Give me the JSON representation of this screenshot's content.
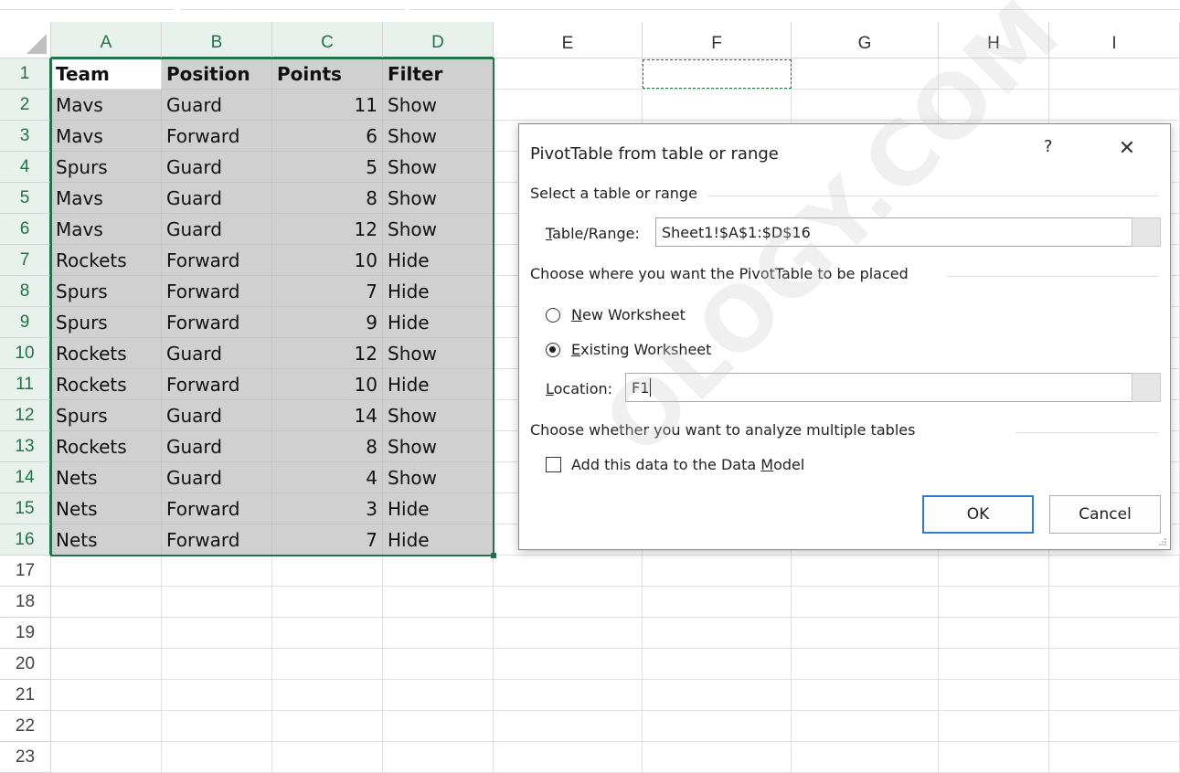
{
  "columns": [
    "A",
    "B",
    "C",
    "D",
    "E",
    "F",
    "G",
    "H",
    "I"
  ],
  "rows": [
    "1",
    "2",
    "3",
    "4",
    "5",
    "6",
    "7",
    "8",
    "9",
    "10",
    "11",
    "12",
    "13",
    "14",
    "15",
    "16",
    "17",
    "18",
    "19",
    "20",
    "21",
    "22",
    "23"
  ],
  "table": {
    "headers": [
      "Team",
      "Position",
      "Points",
      "Filter"
    ],
    "data": [
      [
        "Mavs",
        "Guard",
        "11",
        "Show"
      ],
      [
        "Mavs",
        "Forward",
        "6",
        "Show"
      ],
      [
        "Spurs",
        "Guard",
        "5",
        "Show"
      ],
      [
        "Mavs",
        "Guard",
        "8",
        "Show"
      ],
      [
        "Mavs",
        "Guard",
        "12",
        "Show"
      ],
      [
        "Rockets",
        "Forward",
        "10",
        "Hide"
      ],
      [
        "Spurs",
        "Forward",
        "7",
        "Hide"
      ],
      [
        "Spurs",
        "Forward",
        "9",
        "Hide"
      ],
      [
        "Rockets",
        "Guard",
        "12",
        "Show"
      ],
      [
        "Rockets",
        "Forward",
        "10",
        "Hide"
      ],
      [
        "Spurs",
        "Guard",
        "14",
        "Show"
      ],
      [
        "Rockets",
        "Guard",
        "8",
        "Show"
      ],
      [
        "Nets",
        "Guard",
        "4",
        "Show"
      ],
      [
        "Nets",
        "Forward",
        "3",
        "Hide"
      ],
      [
        "Nets",
        "Forward",
        "7",
        "Hide"
      ]
    ]
  },
  "dialog": {
    "title": "PivotTable from table or range",
    "help": "?",
    "close": "✕",
    "section_select": "Select a table or range",
    "table_range_label_ul": "T",
    "table_range_label_rest": "able/Range:",
    "table_range_value": "Sheet1!$A$1:$D$16",
    "section_place": "Choose where you want the PivotTable to be placed",
    "new_ws_ul": "N",
    "new_ws_rest": "ew Worksheet",
    "existing_ws_ul": "E",
    "existing_ws_rest": "xisting Worksheet",
    "location_label_ul": "L",
    "location_label_rest": "ocation:",
    "location_value": "F1",
    "section_multi": "Choose whether you want to analyze multiple tables",
    "data_model_pre": "Add this data to the Data ",
    "data_model_ul": "M",
    "data_model_post": "odel",
    "ok": "OK",
    "cancel": "Cancel",
    "selected_option": "existing",
    "data_model_checked": false
  },
  "watermark": "OLOGY.COM",
  "colors": {
    "selection": "#217346",
    "shade": "#d0d0d0",
    "ok_border": "#2f7bd6"
  }
}
